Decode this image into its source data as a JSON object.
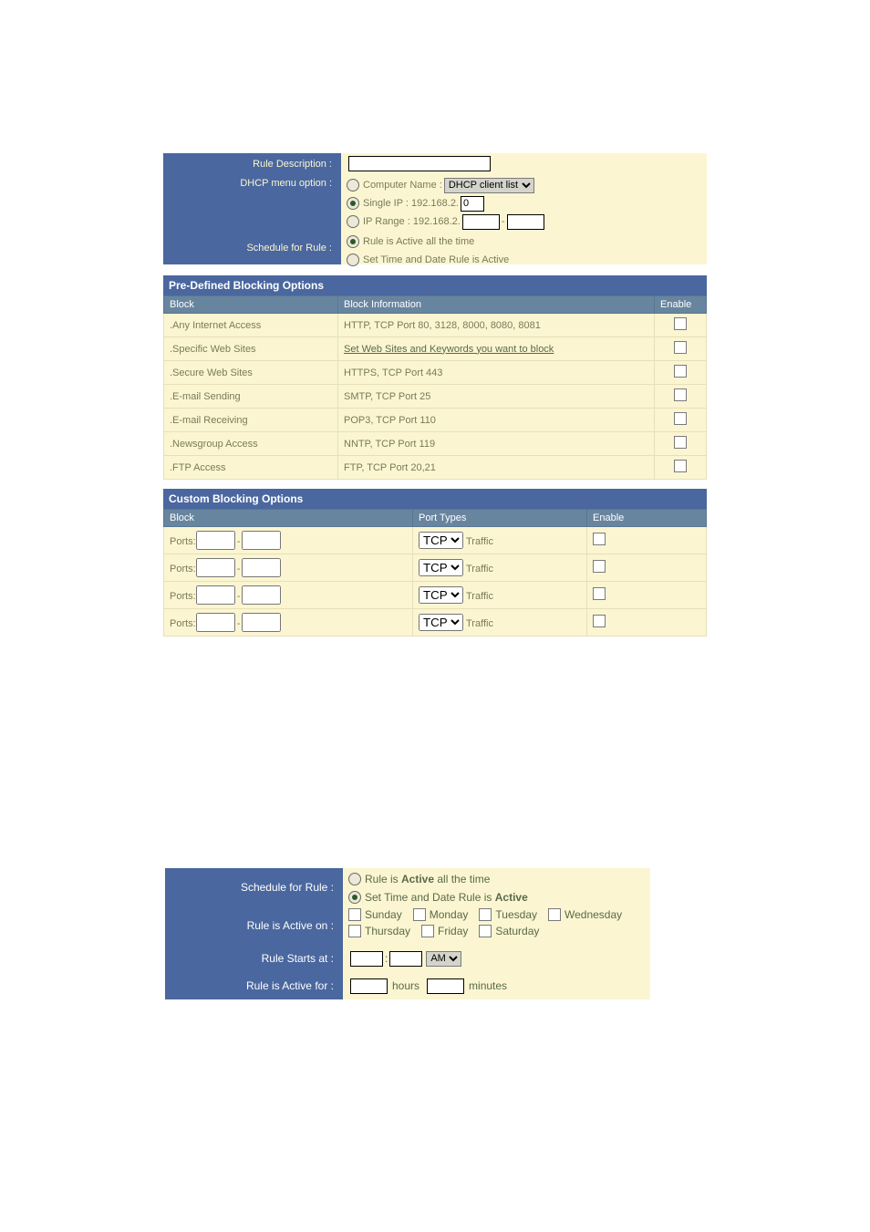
{
  "top": {
    "rule_description_label": "Rule Description :",
    "rule_description_value": "",
    "dhcp_label": "DHCP menu option :",
    "computer_name_label": "Computer Name :",
    "computer_name_select": "DHCP client list",
    "single_ip_label": "Single IP : 192.168.2.",
    "single_ip_value": "0",
    "ip_range_label": "IP Range : 192.168.2.",
    "ip_range_from": "",
    "ip_range_sep": "-",
    "ip_range_to": "",
    "schedule_label": "Schedule for Rule :",
    "sched_opt_active": "Rule is Active all the time",
    "sched_opt_set": "Set Time and Date Rule is Active"
  },
  "predef": {
    "title": "Pre-Defined Blocking Options",
    "hdr_block": "Block",
    "hdr_info": "Block Information",
    "hdr_enable": "Enable",
    "rows": [
      {
        "name": ".Any Internet Access",
        "info": "HTTP, TCP Port 80, 3128, 8000, 8080, 8081"
      },
      {
        "name": ".Specific Web Sites",
        "link": "Set Web Sites and Keywords you want to block"
      },
      {
        "name": ".Secure Web Sites",
        "info": "HTTPS, TCP Port 443"
      },
      {
        "name": ".E-mail Sending",
        "info": "SMTP, TCP Port 25"
      },
      {
        "name": ".E-mail Receiving",
        "info": "POP3, TCP Port 110"
      },
      {
        "name": ".Newsgroup Access",
        "info": "NNTP, TCP Port 119"
      },
      {
        "name": ".FTP Access",
        "info": "FTP, TCP Port 20,21"
      }
    ]
  },
  "custom": {
    "title": "Custom Blocking Options",
    "hdr_block": "Block",
    "hdr_types": "Port Types",
    "hdr_enable": "Enable",
    "ports_label": "Ports:",
    "sep": "-",
    "proto": "TCP",
    "traffic": "Traffic"
  },
  "sched": {
    "row1_label": "Schedule for Rule :",
    "opt_active": "Rule is Active all the time",
    "opt_set": "Set Time and Date Rule is Active",
    "row2_label": "Rule is Active on :",
    "days": [
      "Sunday",
      "Monday",
      "Tuesday",
      "Wednesday",
      "Thursday",
      "Friday",
      "Saturday"
    ],
    "row3_label": "Rule Starts at :",
    "time_colon": ":",
    "ampm": "AM",
    "row4_label": "Rule is Active for :",
    "hours_label": "hours",
    "minutes_label": "minutes"
  }
}
